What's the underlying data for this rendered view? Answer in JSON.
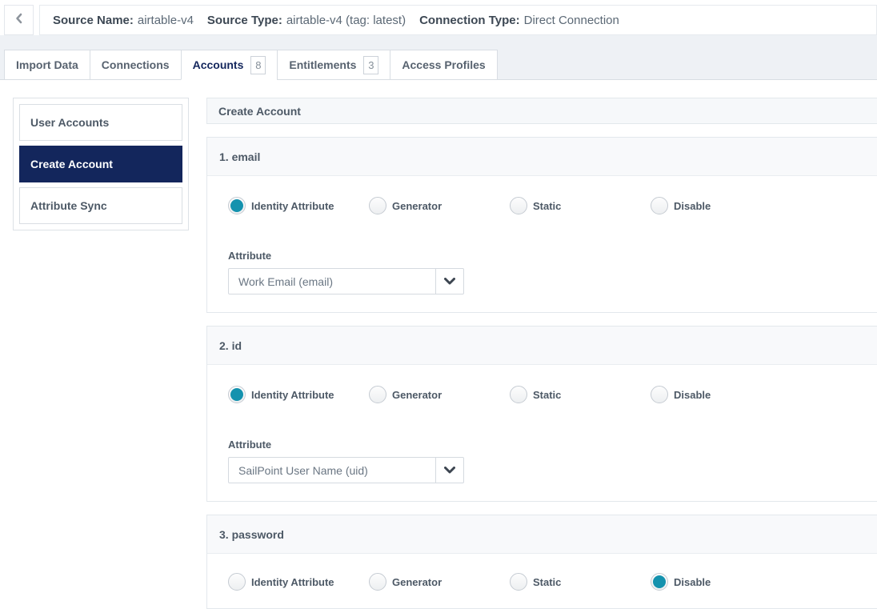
{
  "header": {
    "fields": [
      {
        "label": "Source Name:",
        "value": "airtable-v4"
      },
      {
        "label": "Source Type:",
        "value": "airtable-v4 (tag: latest)"
      },
      {
        "label": "Connection Type:",
        "value": "Direct Connection"
      }
    ]
  },
  "tabs": [
    {
      "label": "Import Data"
    },
    {
      "label": "Connections"
    },
    {
      "label": "Accounts",
      "badge": "8",
      "active": true
    },
    {
      "label": "Entitlements",
      "badge": "3"
    },
    {
      "label": "Access Profiles"
    }
  ],
  "sidebar": {
    "items": [
      {
        "label": "User Accounts",
        "active": false
      },
      {
        "label": "Create Account",
        "active": true
      },
      {
        "label": "Attribute Sync",
        "active": false
      }
    ]
  },
  "panel": {
    "title": "Create Account",
    "sections": [
      {
        "title": "1. email",
        "options": [
          "Identity Attribute",
          "Generator",
          "Static",
          "Disable"
        ],
        "selected": "Identity Attribute",
        "attribute_label": "Attribute",
        "attribute_value": "Work Email (email)"
      },
      {
        "title": "2. id",
        "options": [
          "Identity Attribute",
          "Generator",
          "Static",
          "Disable"
        ],
        "selected": "Identity Attribute",
        "attribute_label": "Attribute",
        "attribute_value": "SailPoint User Name (uid)"
      },
      {
        "title": "3. password",
        "options": [
          "Identity Attribute",
          "Generator",
          "Static",
          "Disable"
        ],
        "selected": "Disable"
      }
    ]
  },
  "icons": {
    "back": "chevron-left-icon",
    "select": "chevron-down-icon"
  },
  "colors": {
    "navy_accent": "#13265c",
    "radio_selected_teal": "#1492ae",
    "band_gray": "#eef1f5"
  }
}
